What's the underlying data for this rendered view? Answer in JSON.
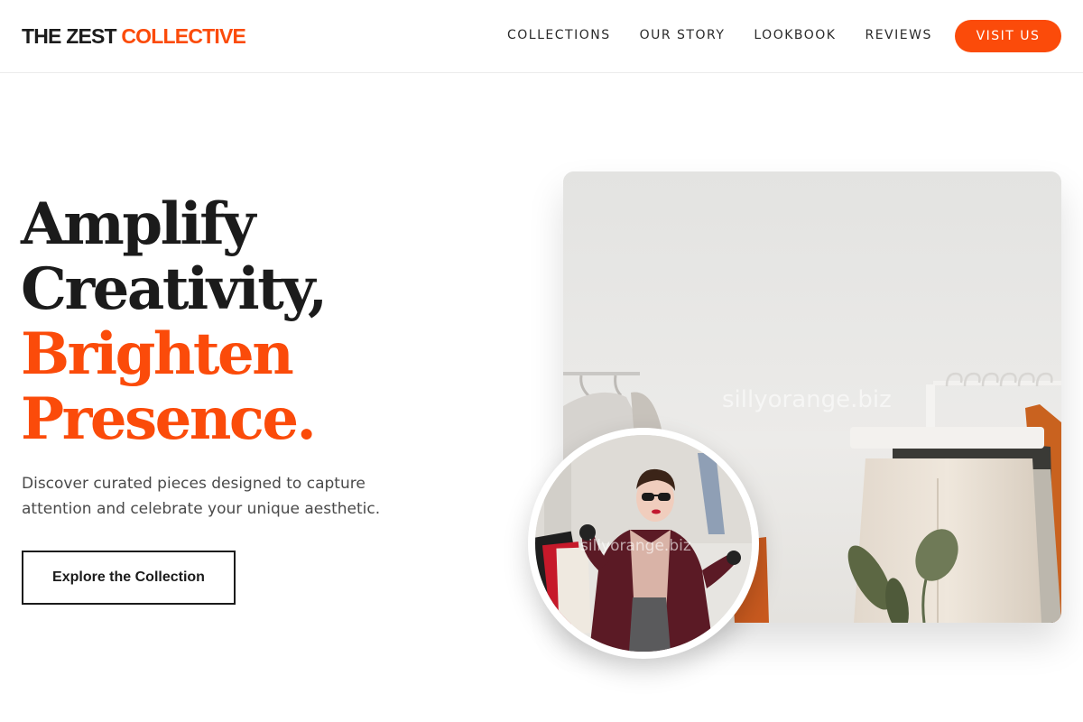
{
  "brand": {
    "part1": "THE ZEST",
    "part2": "COLLECTIVE",
    "accent_color": "#fb4b0a"
  },
  "nav": {
    "items": [
      {
        "label": "COLLECTIONS"
      },
      {
        "label": "OUR STORY"
      },
      {
        "label": "LOOKBOOK"
      },
      {
        "label": "REVIEWS"
      }
    ],
    "cta_label": "VISIT US"
  },
  "hero": {
    "line1": "Amplify",
    "line2": "Creativity,",
    "line3": "Brighten",
    "line4": "Presence.",
    "subtext": "Discover curated pieces designed to capture attention and celebrate your unique aesthetic.",
    "button_label": "Explore the Collection"
  },
  "images": {
    "main_alt": "Clothing rack with garments and a potted plant",
    "circle_alt": "Woman in burgundy coat and sunglasses holding shopping bags",
    "watermark": "sillyorange.biz"
  }
}
